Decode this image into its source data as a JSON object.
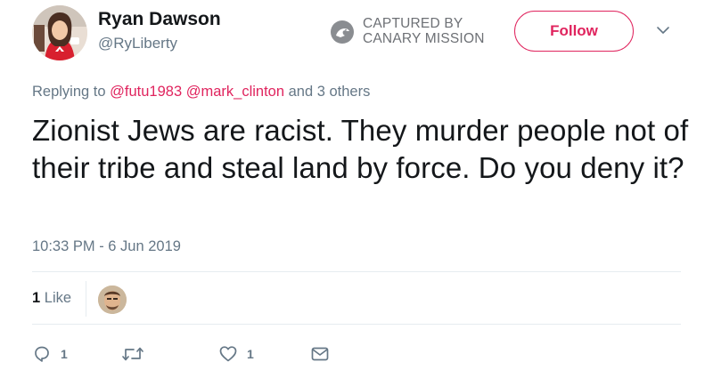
{
  "user": {
    "name": "Ryan Dawson",
    "handle": "@RyLiberty"
  },
  "watermark": {
    "line1": "CAPTURED BY",
    "line2": "CANARY MISSION"
  },
  "follow_button": {
    "label": "Follow"
  },
  "reply_context": {
    "prefix": "Replying to",
    "mention1": "@futu1983",
    "mention2": "@mark_clinton",
    "suffix": "and 3 others"
  },
  "tweet": {
    "text": "Zionist Jews are racist. They murder people not of their tribe and steal land by force. Do you deny it?",
    "timestamp": "10:33 PM - 6 Jun 2019"
  },
  "likes": {
    "count": "1",
    "label": "Like"
  },
  "actions": {
    "reply_count": "1",
    "like_count": "1"
  },
  "colors": {
    "accent": "#e0245e",
    "muted": "#657786",
    "text": "#14171a",
    "divider": "#e6ecf0"
  },
  "icons": {
    "reply": "reply-icon",
    "retweet": "retweet-icon",
    "like": "heart-icon",
    "dm": "envelope-icon",
    "caret": "chevron-down-icon"
  }
}
